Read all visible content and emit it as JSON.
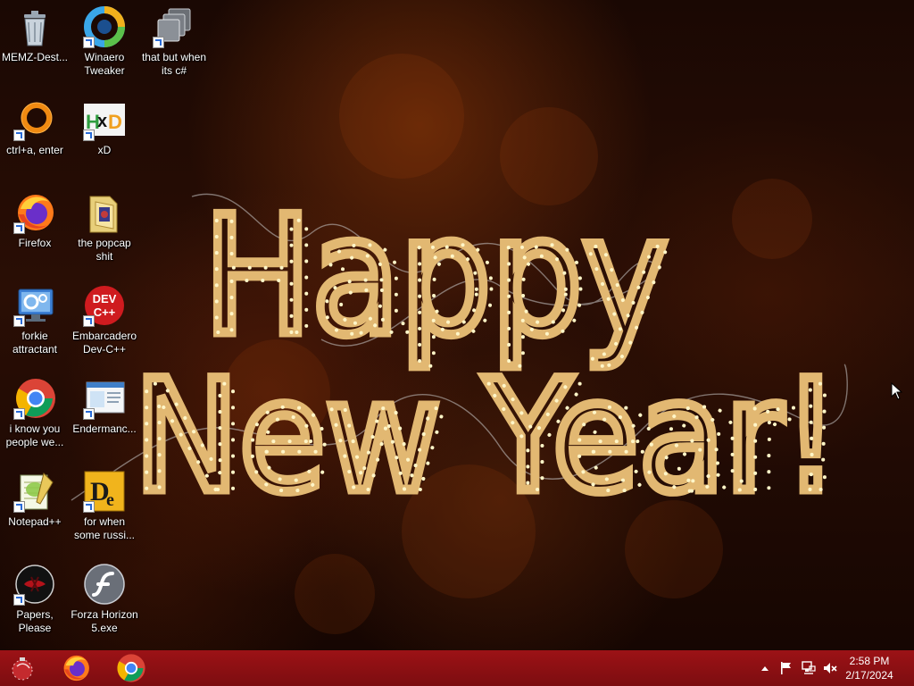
{
  "wallpaper": {
    "line1": "Happy",
    "line2": "New Year!",
    "glow_color": "#e2b872"
  },
  "desktop_icons": [
    {
      "label": "MEMZ-Dest...",
      "icon": "recycle-bin-icon"
    },
    {
      "label": "Winaero Tweaker",
      "icon": "winaero-tweaker-icon"
    },
    {
      "label": "that but when its c#",
      "icon": "stacked-windows-icon"
    },
    {
      "label": "ctrl+a, enter",
      "icon": "orange-ring-icon"
    },
    {
      "label": "xD",
      "icon": "hxd-editor-icon"
    },
    {
      "label": "Firefox",
      "icon": "firefox-icon"
    },
    {
      "label": "the popcap shit",
      "icon": "folder-icon"
    },
    {
      "label": "forkie attractant",
      "icon": "settings-monitor-icon"
    },
    {
      "label": "Embarcadero Dev-C++",
      "icon": "dev-cpp-icon"
    },
    {
      "label": "i know you people we...",
      "icon": "chrome-icon"
    },
    {
      "label": "Endermanc...",
      "icon": "window-app-icon"
    },
    {
      "label": "Notepad++",
      "icon": "notepad-plus-plus-icon"
    },
    {
      "label": "for when some russi...",
      "icon": "dependency-walker-icon"
    },
    {
      "label": "Papers, Please",
      "icon": "papers-please-icon"
    },
    {
      "label": "Forza Horizon 5.exe",
      "icon": "flash-player-icon"
    }
  ],
  "taskbar": {
    "start_icon": "start-ornament-icon",
    "pinned": [
      {
        "name": "Firefox",
        "icon": "firefox-icon"
      },
      {
        "name": "Google Chrome",
        "icon": "chrome-icon"
      }
    ],
    "tray_icons": [
      "show-hidden-icons-arrow",
      "action-center-flag-icon",
      "network-icon",
      "volume-muted-icon"
    ],
    "clock": {
      "time": "2:58 PM",
      "date": "2/17/2024"
    },
    "color": "#8f1013"
  }
}
